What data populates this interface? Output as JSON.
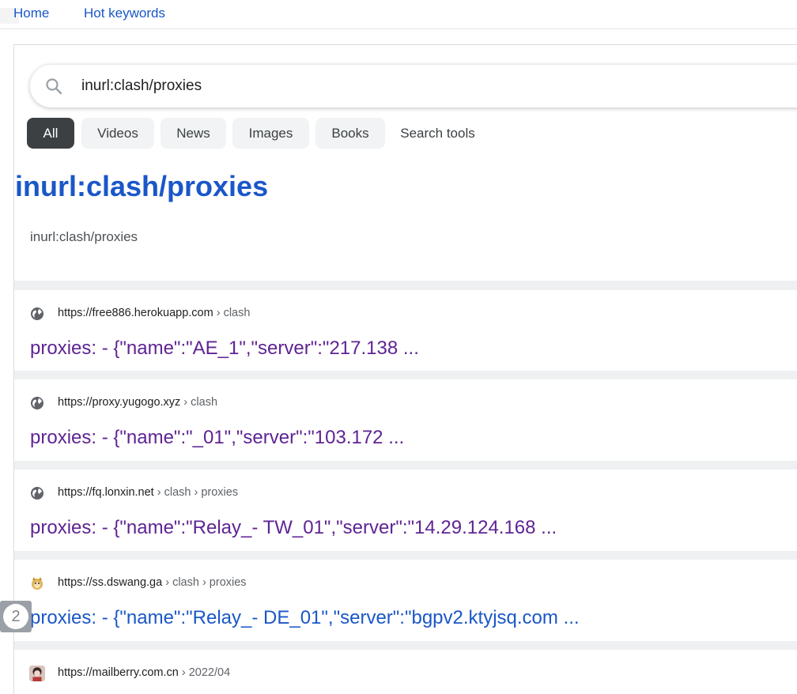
{
  "nav": {
    "home": "Home",
    "hot_keywords": "Hot keywords"
  },
  "search": {
    "query": "inurl:clash/proxies"
  },
  "tabs": [
    "All",
    "Videos",
    "News",
    "Images",
    "Books",
    "Search tools"
  ],
  "heading": {
    "title": "inurl:clash/proxies",
    "subtitle": "inurl:clash/proxies"
  },
  "results": [
    {
      "url": "https://free886.herokuapp.com",
      "crumbs": " › clash",
      "title": "proxies: - {\"name\":\"AE_1\",\"server\":\"217.138 ...",
      "favicon": "globe-icon"
    },
    {
      "url": "https://proxy.yugogo.xyz",
      "crumbs": " › clash",
      "title": "proxies: - {\"name\":\"_01\",\"server\":\"103.172 ...",
      "favicon": "globe-icon"
    },
    {
      "url": "https://fq.lonxin.net",
      "crumbs": " › clash › proxies",
      "title": "proxies: - {\"name\":\"Relay_- TW_01\",\"server\":\"14.29.124.168 ...",
      "favicon": "globe-icon"
    },
    {
      "url": "https://ss.dswang.ga",
      "crumbs": " › clash › proxies",
      "title": "proxies: - {\"name\":\"Relay_- DE_01\",\"server\":\"bgpv2.ktyjsq.com ...",
      "favicon": "doge-icon"
    },
    {
      "url": "https://mailberry.com.cn",
      "crumbs": " › 2022/04",
      "title": "",
      "favicon": "avatar-icon"
    }
  ],
  "page_badge": "2",
  "colors": {
    "link_blue": "#1a57c8",
    "visited_purple": "#5f2493",
    "active_tab": "#3c4043"
  }
}
